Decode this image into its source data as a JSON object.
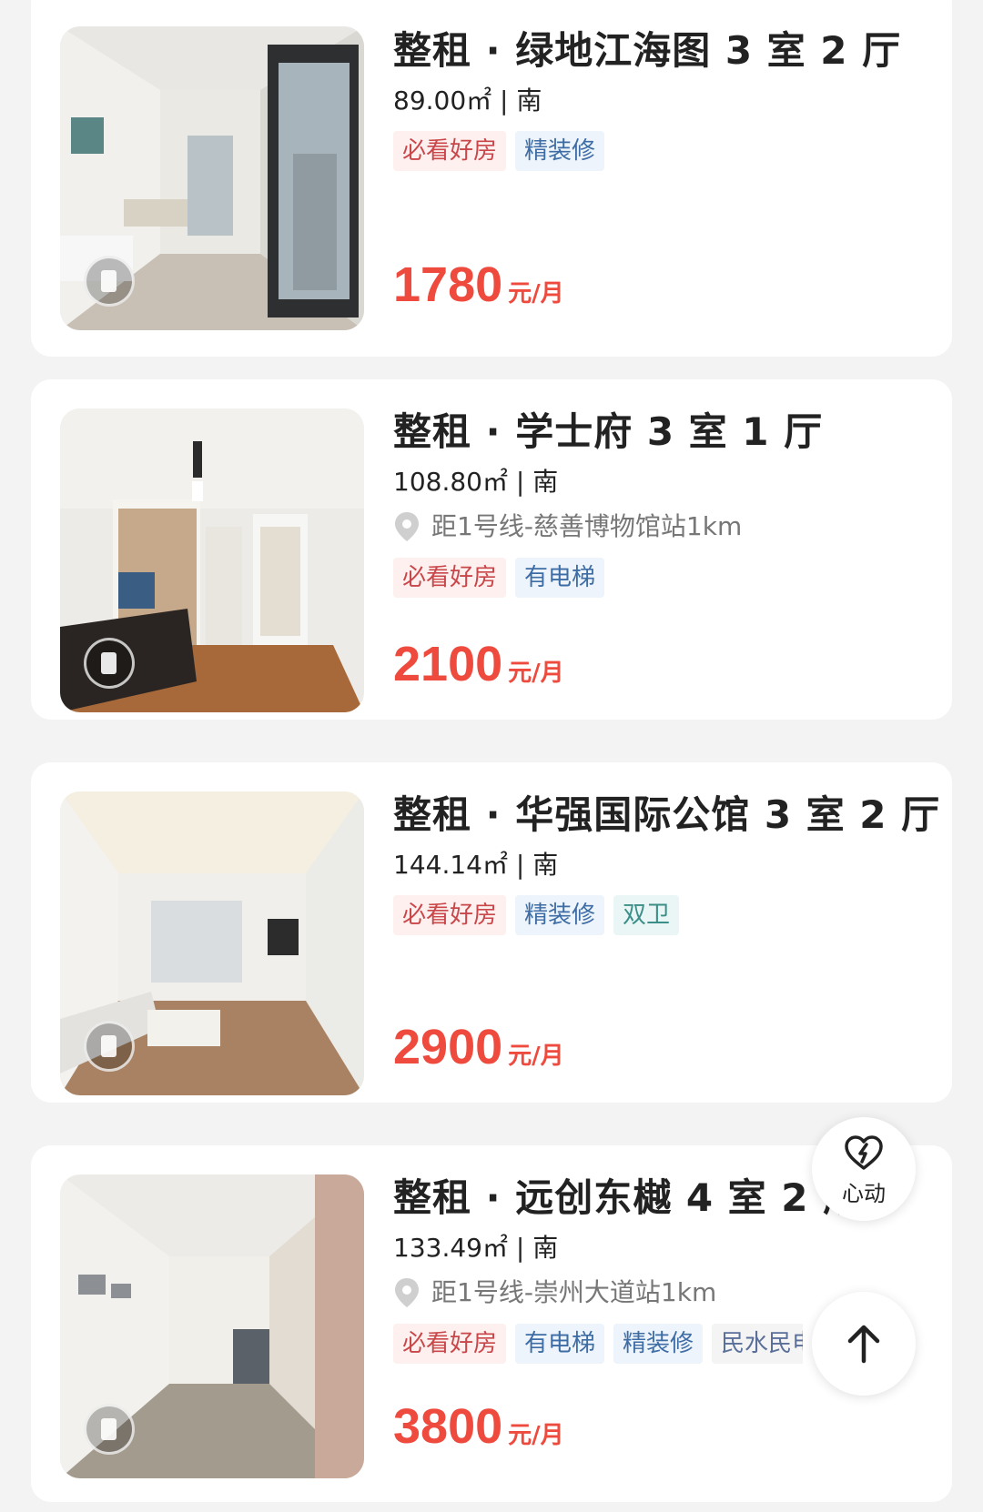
{
  "listings": [
    {
      "title": "整租 · 绿地江海图 3 室 2 厅",
      "area": "89.00㎡ | 南",
      "location": "",
      "tags": [
        {
          "label": "必看好房",
          "style": "red"
        },
        {
          "label": "精装修",
          "style": "blue"
        }
      ],
      "price": "1780",
      "price_unit": "元/月",
      "photo_icon": "apartment-living-room-photo"
    },
    {
      "title": "整租 · 学士府 3 室 1 厅",
      "area": "108.80㎡ | 南",
      "location": "距1号线-慈善博物馆站1km",
      "tags": [
        {
          "label": "必看好房",
          "style": "red"
        },
        {
          "label": "有电梯",
          "style": "blue"
        }
      ],
      "price": "2100",
      "price_unit": "元/月",
      "photo_icon": "apartment-dining-room-photo"
    },
    {
      "title": "整租 · 华强国际公馆 3 室 2 厅",
      "area": "144.14㎡ | 南",
      "location": "",
      "tags": [
        {
          "label": "必看好房",
          "style": "red"
        },
        {
          "label": "精装修",
          "style": "blue"
        },
        {
          "label": "双卫",
          "style": "teal"
        }
      ],
      "price": "2900",
      "price_unit": "元/月",
      "photo_icon": "apartment-living-room-photo"
    },
    {
      "title": "整租 · 远创东樾 4 室 2 厅",
      "area": "133.49㎡ | 南",
      "location": "距1号线-崇州大道站1km",
      "tags": [
        {
          "label": "必看好房",
          "style": "red"
        },
        {
          "label": "有电梯",
          "style": "blue"
        },
        {
          "label": "精装修",
          "style": "blue"
        },
        {
          "label": "民水民电",
          "style": "gray"
        }
      ],
      "price": "3800",
      "price_unit": "元/月",
      "photo_icon": "apartment-hallway-photo"
    }
  ],
  "fab": {
    "like_label": "心动",
    "like_icon": "heart-lightning-icon",
    "top_icon": "arrow-up-icon"
  },
  "colors": {
    "price": "#ee4b3e",
    "tag_red_text": "#c9474a",
    "tag_blue_text": "#3e6da5",
    "background": "#f3f3f3"
  }
}
